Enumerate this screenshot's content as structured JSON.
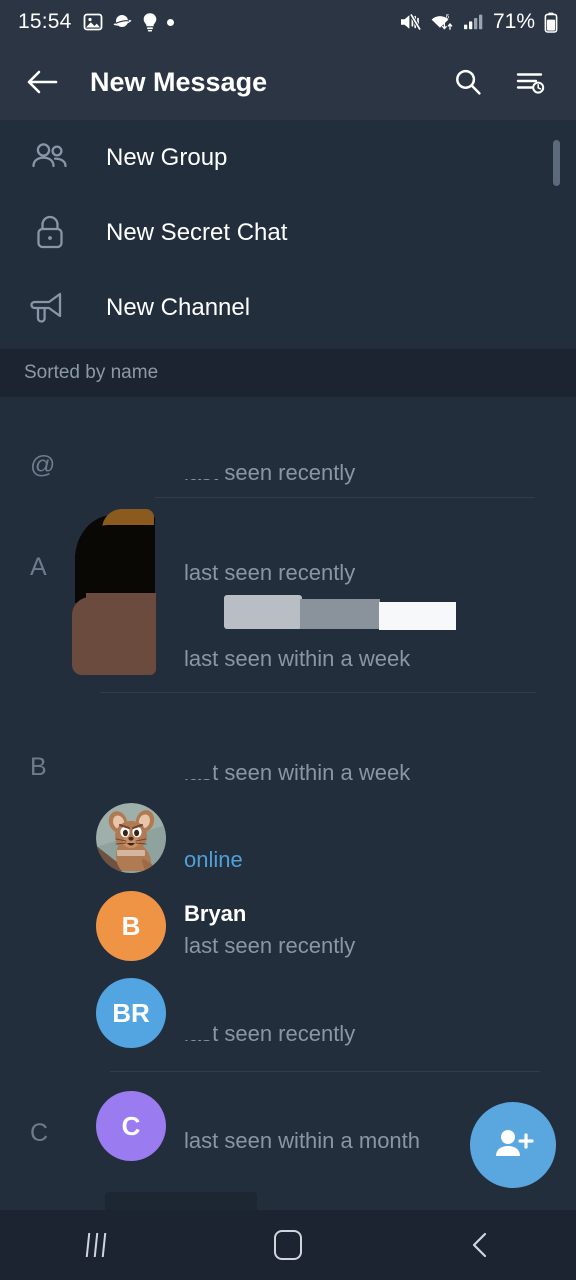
{
  "status_bar": {
    "time": "15:54",
    "battery_percent": "71%",
    "left_icons": [
      "image-icon",
      "planet-icon",
      "lightbulb-icon",
      "dot-icon"
    ],
    "right_icons": [
      "mute-icon",
      "wifi-icon",
      "signal-icon",
      "battery-icon"
    ]
  },
  "app_bar": {
    "title": "New Message",
    "back_icon": "back-arrow-icon",
    "search_icon": "search-icon",
    "sort_icon": "sort-by-time-icon"
  },
  "menu": {
    "items": [
      {
        "label": "New Group",
        "icon": "group-people-icon"
      },
      {
        "label": "New Secret Chat",
        "icon": "lock-icon"
      },
      {
        "label": "New Channel",
        "icon": "megaphone-icon"
      }
    ]
  },
  "sorted_bar": {
    "label": "Sorted by name"
  },
  "contacts": [
    {
      "section": "@",
      "name": "",
      "name_redacted": true,
      "status": "last seen recently",
      "status_type": "offline",
      "avatar": {
        "type": "redacted"
      }
    },
    {
      "section": "A",
      "name": "",
      "name_redacted": true,
      "status": "last seen recently",
      "status_type": "offline",
      "avatar": {
        "type": "redacted"
      }
    },
    {
      "section": "",
      "name": "",
      "name_redacted": true,
      "status": "last seen within a week",
      "status_type": "offline",
      "avatar": {
        "type": "redacted"
      }
    },
    {
      "section": "B",
      "name": "",
      "name_redacted": true,
      "status": "last seen within a week",
      "status_type": "offline",
      "avatar": {
        "type": "redacted"
      }
    },
    {
      "section": "",
      "name": "",
      "name_redacted": true,
      "status": "online",
      "status_type": "online",
      "avatar": {
        "type": "photo",
        "photo": "jerry-mouse-avatar"
      }
    },
    {
      "section": "",
      "name": "Bryan",
      "name_redacted": false,
      "status": "last seen recently",
      "status_type": "offline",
      "avatar": {
        "type": "initials",
        "initials": "B",
        "color": "#ef9445"
      }
    },
    {
      "section": "",
      "name": "",
      "name_redacted": true,
      "status": "last seen recently",
      "status_type": "offline",
      "avatar": {
        "type": "initials",
        "initials": "BR",
        "color": "#52a5e0"
      }
    },
    {
      "section": "C",
      "name": "",
      "name_redacted": true,
      "status": "last seen within a month",
      "status_type": "offline",
      "avatar": {
        "type": "initials",
        "initials": "C",
        "color": "#9b7bf0"
      }
    }
  ],
  "fab": {
    "icon": "add-person-icon",
    "color": "#5aa7e0"
  },
  "nav_bar": {
    "recents_label": "recents-icon",
    "home_label": "home-icon",
    "back_label": "back-icon"
  },
  "colors": {
    "app_bar_bg": "#2b3544",
    "list_bg": "#222e3c",
    "section_bar_bg": "#1b2430",
    "accent": "#5aa7e0",
    "online": "#4f9fd8",
    "secondary_text": "#8a96a4"
  }
}
